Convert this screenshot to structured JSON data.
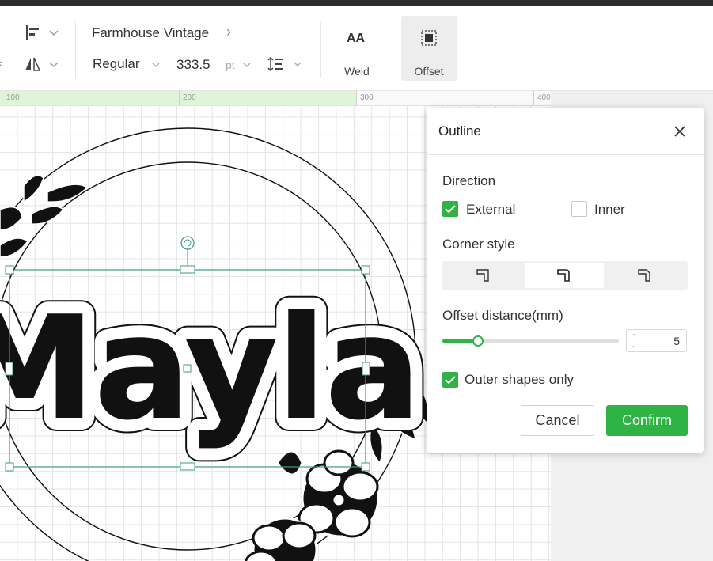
{
  "toolbar": {
    "font_family": "Farmhouse Vintage",
    "font_style": "Regular",
    "font_size": "333.5",
    "font_unit": "pt",
    "weld_label": "Weld",
    "offset_label": "Offset",
    "icons": [
      "align-left-icon",
      "flip-icon",
      "line-spacing-icon",
      "weld-icon",
      "offset-icon"
    ]
  },
  "ruler": {
    "ticks": [
      "100",
      "200",
      "300",
      "400"
    ]
  },
  "canvas": {
    "text": "Mayla"
  },
  "dialog": {
    "title": "Outline",
    "direction_label": "Direction",
    "external_label": "External",
    "external_checked": true,
    "inner_label": "Inner",
    "inner_checked": false,
    "corner_label": "Corner style",
    "corner_options": [
      "sharp-corner-icon",
      "round-corner-icon",
      "bevel-corner-icon"
    ],
    "corner_selected": 1,
    "distance_label": "Offset distance(mm)",
    "distance_value": "5",
    "distance_slider_fraction": 0.2,
    "outer_only_label": "Outer shapes only",
    "outer_only_checked": true,
    "cancel_label": "Cancel",
    "confirm_label": "Confirm"
  },
  "colors": {
    "accent": "#2fb344",
    "topbar": "#2b2b2f",
    "selection": "#3a9a8a"
  }
}
